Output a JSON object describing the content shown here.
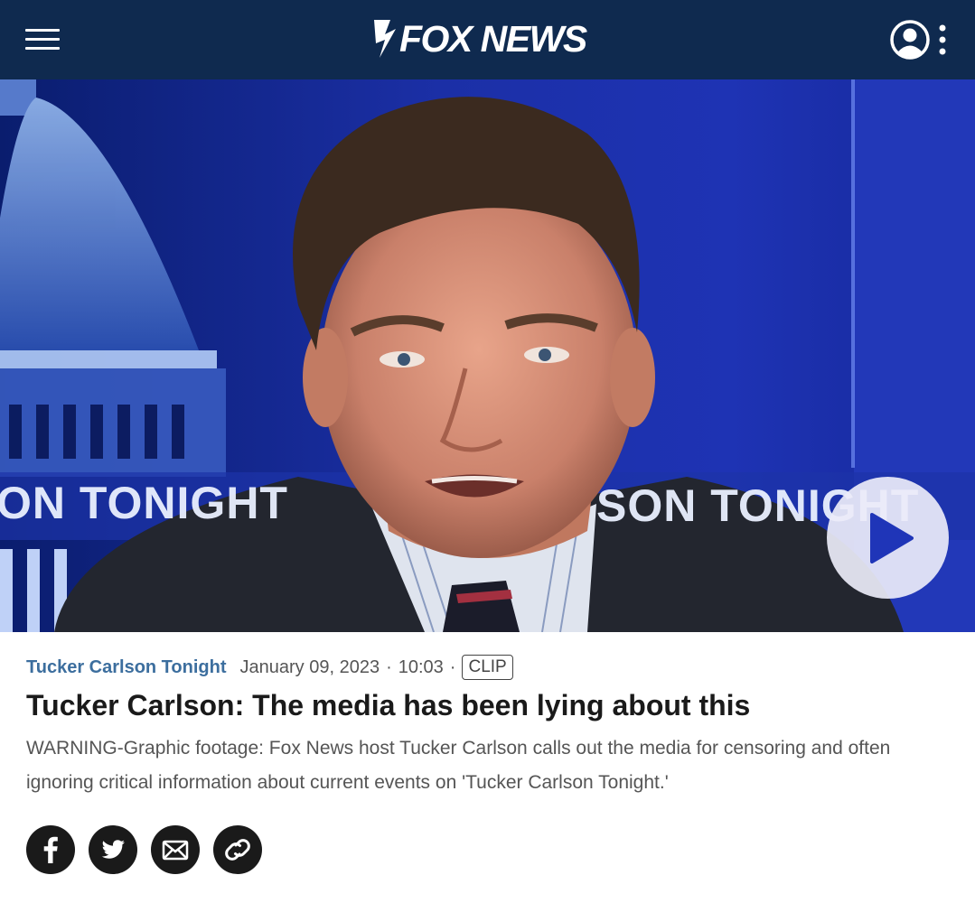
{
  "header": {
    "logo_text": "FOX NEWS",
    "menu_icon": "hamburger-menu-icon",
    "account_icon": "user-account-icon",
    "more_icon": "vertical-dots-icon",
    "background_color": "#0f2a4f"
  },
  "video": {
    "lower_third_left": "ON TONIGHT",
    "lower_third_right": "SON TONIGHT",
    "play_icon": "play-icon",
    "accent_color": "#1e33b4"
  },
  "article": {
    "show_name": "Tucker Carlson Tonight",
    "date": "January 09, 2023",
    "separator": "·",
    "duration": "10:03",
    "badge": "CLIP",
    "headline": "Tucker Carlson: The media has been lying about this",
    "description": "WARNING-Graphic footage: Fox News host Tucker Carlson calls out the media for censoring and often ignoring critical information about current events on 'Tucker Carlson Tonight.'"
  },
  "share": {
    "buttons": [
      {
        "icon": "facebook-icon"
      },
      {
        "icon": "twitter-icon"
      },
      {
        "icon": "email-icon"
      },
      {
        "icon": "link-icon"
      }
    ]
  }
}
